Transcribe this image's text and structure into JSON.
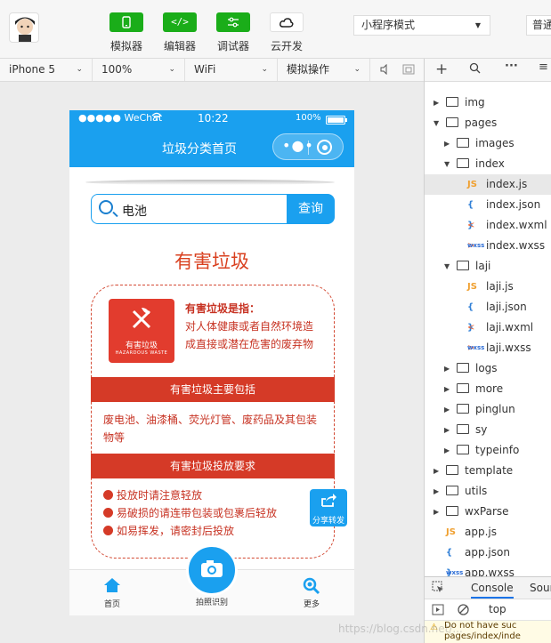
{
  "toolbar": {
    "simulator": {
      "icon": "phone-icon",
      "label": "模拟器"
    },
    "editor": {
      "icon": "code-icon",
      "glyph": "</>",
      "label": "编辑器"
    },
    "debugger": {
      "icon": "debug-icon",
      "label": "调试器"
    },
    "cloud": {
      "icon": "cloud-icon",
      "label": "云开发"
    },
    "mode_select": "小程序模式",
    "normal_mode": "普通"
  },
  "simbar": {
    "device": "iPhone 5",
    "zoom": "100%",
    "network": "WiFi",
    "operation": "模拟操作"
  },
  "phone": {
    "status": {
      "signal": "●●●●● WeChat",
      "time": "10:22",
      "battery": "100%"
    },
    "nav_title": "垃圾分类首页",
    "search": {
      "value": "电池",
      "button": "查询"
    },
    "category_title": "有害垃圾",
    "logo": {
      "text_cn": "有害垃圾",
      "text_en": "HAZARDOUS WASTE"
    },
    "definition": {
      "title": "有害垃圾是指：",
      "text": "对人体健康或者自然环境造成直接或潜在危害的废弃物"
    },
    "includes": {
      "title": "有害垃圾主要包括",
      "text": "废电池、油漆桶、荧光灯管、废药品及其包装物等"
    },
    "requirements": {
      "title": "有害垃圾投放要求",
      "items": [
        "投放时请注意轻放",
        "易破损的请连带包装或包裹后轻放",
        "如易挥发，请密封后投放"
      ]
    },
    "share_label": "分享转发",
    "tabs": {
      "home": "首页",
      "camera": "拍照识别",
      "more": "更多"
    }
  },
  "filetree": [
    {
      "name": "img",
      "type": "folder",
      "depth": 0,
      "expanded": false
    },
    {
      "name": "pages",
      "type": "folder",
      "depth": 0,
      "expanded": true
    },
    {
      "name": "images",
      "type": "folder",
      "depth": 1,
      "expanded": false
    },
    {
      "name": "index",
      "type": "folder",
      "depth": 1,
      "expanded": true
    },
    {
      "name": "index.js",
      "type": "js",
      "depth": 2,
      "selected": true
    },
    {
      "name": "index.json",
      "type": "json",
      "depth": 2
    },
    {
      "name": "index.wxml",
      "type": "wxml",
      "depth": 2
    },
    {
      "name": "index.wxss",
      "type": "wxss",
      "depth": 2
    },
    {
      "name": "laji",
      "type": "folder",
      "depth": 1,
      "expanded": true
    },
    {
      "name": "laji.js",
      "type": "js",
      "depth": 2
    },
    {
      "name": "laji.json",
      "type": "json",
      "depth": 2
    },
    {
      "name": "laji.wxml",
      "type": "wxml",
      "depth": 2
    },
    {
      "name": "laji.wxss",
      "type": "wxss",
      "depth": 2
    },
    {
      "name": "logs",
      "type": "folder",
      "depth": 1,
      "expanded": false
    },
    {
      "name": "more",
      "type": "folder",
      "depth": 1,
      "expanded": false
    },
    {
      "name": "pinglun",
      "type": "folder",
      "depth": 1,
      "expanded": false
    },
    {
      "name": "sy",
      "type": "folder",
      "depth": 1,
      "expanded": false
    },
    {
      "name": "typeinfo",
      "type": "folder",
      "depth": 1,
      "expanded": false
    },
    {
      "name": "template",
      "type": "folder",
      "depth": 0,
      "expanded": false
    },
    {
      "name": "utils",
      "type": "folder",
      "depth": 0,
      "expanded": false
    },
    {
      "name": "wxParse",
      "type": "folder",
      "depth": 0,
      "expanded": false
    },
    {
      "name": "app.js",
      "type": "js",
      "depth": 0
    },
    {
      "name": "app.json",
      "type": "json",
      "depth": 0
    },
    {
      "name": "app.wxss",
      "type": "wxss",
      "depth": 0
    }
  ],
  "console": {
    "tab_console": "Console",
    "tab_sources": "Sour",
    "context": "top",
    "message": "Do not have suc pages/index/inde"
  },
  "watermark": "https://blog.csdn.net/...",
  "colors": {
    "accent": "#1aa0ef",
    "danger": "#d53a27",
    "green": "#1aad19"
  }
}
